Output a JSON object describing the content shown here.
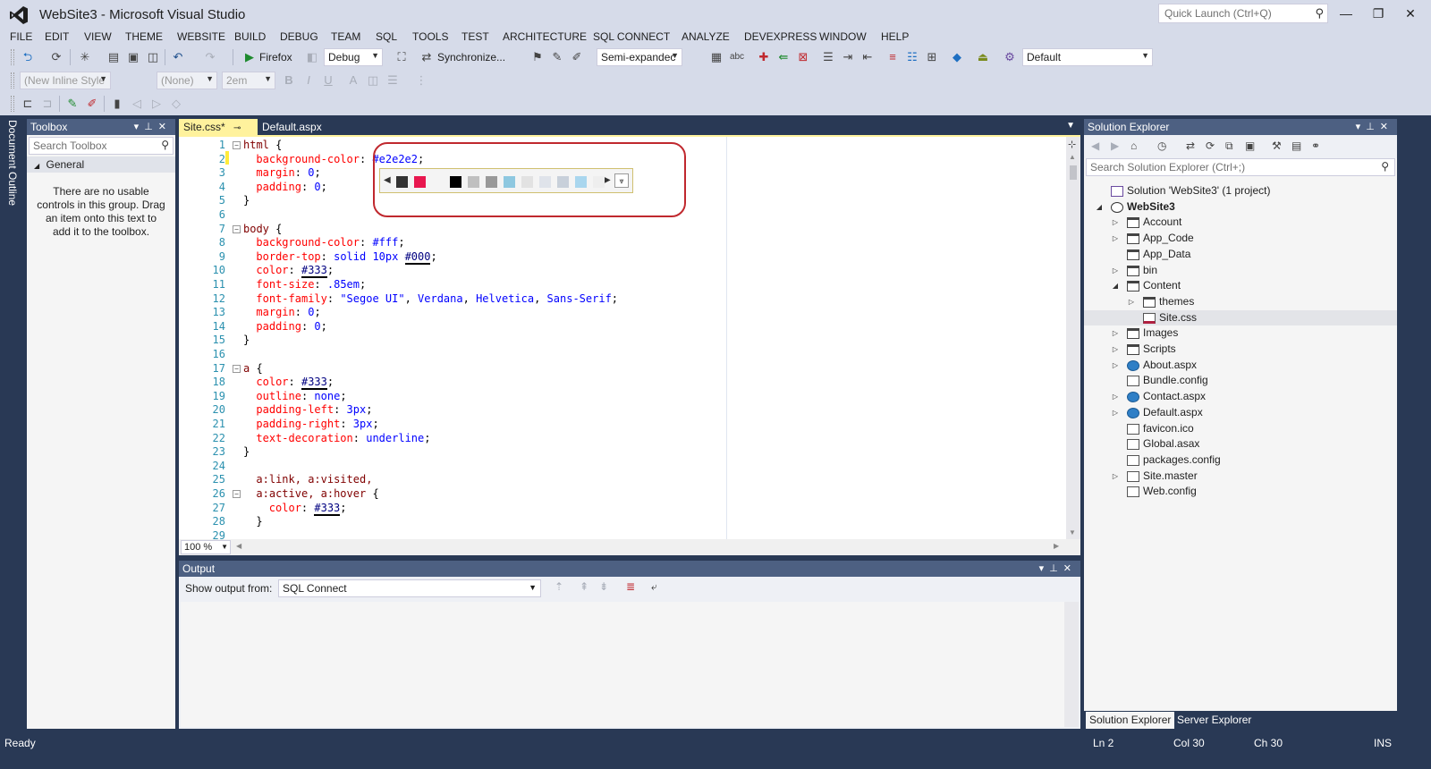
{
  "window": {
    "title": "WebSite3 - Microsoft Visual Studio",
    "quick_launch_placeholder": "Quick Launch (Ctrl+Q)",
    "minimize": "—",
    "restore": "❐",
    "close": "✕"
  },
  "menu": [
    "FILE",
    "EDIT",
    "VIEW",
    "THEME",
    "WEBSITE",
    "BUILD",
    "DEBUG",
    "TEAM",
    "SQL",
    "TOOLS",
    "TEST",
    "ARCHITECTURE",
    "SQL CONNECT",
    "ANALYZE",
    "DEVEXPRESS",
    "WINDOW",
    "HELP"
  ],
  "toolbar": {
    "run_target": "Firefox",
    "config": "Debug",
    "synchronize": "Synchronize...",
    "outline_mode": "Semi-expandec",
    "layout": "Default",
    "style_combo": "(New Inline Style",
    "font_combo": "(None)",
    "size_combo": "2em"
  },
  "toolbox": {
    "title": "Toolbox",
    "search_placeholder": "Search Toolbox",
    "group": "General",
    "empty_text": "There are no usable controls in this group. Drag an item onto this text to add it to the toolbox."
  },
  "left_tab": "Document Outline",
  "editor": {
    "tabs": [
      "Site.css*",
      "Default.aspx"
    ],
    "zoom": "100 %",
    "swatches": [
      "#333333",
      "#e8174f",
      "#f4f4f4",
      "#000000",
      "#c0c0c0",
      "#999999",
      "#8ec8e0",
      "#e2e2e2",
      "#dfe3ea",
      "#c8d0da",
      "#a9d6ee",
      "#eeeeee"
    ],
    "lines": [
      {
        "n": "1",
        "fold": "−",
        "indent": 0,
        "parts": [
          [
            "sel",
            "html"
          ],
          [
            "pun",
            " {"
          ]
        ]
      },
      {
        "n": "2",
        "fold": "",
        "indent": 2,
        "parts": [
          [
            "prop",
            "background-color"
          ],
          [
            "pun",
            ": "
          ],
          [
            "val",
            "#e2e2e2"
          ],
          [
            "pun",
            ";"
          ]
        ]
      },
      {
        "n": "3",
        "fold": "",
        "indent": 2,
        "parts": [
          [
            "prop",
            "margin"
          ],
          [
            "pun",
            ": "
          ],
          [
            "val",
            "0"
          ],
          [
            "pun",
            ";"
          ]
        ]
      },
      {
        "n": "4",
        "fold": "",
        "indent": 2,
        "parts": [
          [
            "prop",
            "padding"
          ],
          [
            "pun",
            ": "
          ],
          [
            "val",
            "0"
          ],
          [
            "pun",
            ";"
          ]
        ]
      },
      {
        "n": "5",
        "fold": "",
        "indent": 0,
        "parts": [
          [
            "pun",
            "}"
          ]
        ]
      },
      {
        "n": "6",
        "fold": "",
        "indent": 0,
        "parts": []
      },
      {
        "n": "7",
        "fold": "−",
        "indent": 0,
        "parts": [
          [
            "sel",
            "body"
          ],
          [
            "pun",
            " {"
          ]
        ]
      },
      {
        "n": "8",
        "fold": "",
        "indent": 2,
        "parts": [
          [
            "prop",
            "background-color"
          ],
          [
            "pun",
            ": "
          ],
          [
            "val",
            "#fff"
          ],
          [
            "pun",
            ";"
          ]
        ]
      },
      {
        "n": "9",
        "fold": "",
        "indent": 2,
        "parts": [
          [
            "prop",
            "border-top"
          ],
          [
            "pun",
            ": "
          ],
          [
            "val",
            "solid 10px "
          ],
          [
            "hex",
            "#000"
          ],
          [
            "pun",
            ";"
          ]
        ]
      },
      {
        "n": "10",
        "fold": "",
        "indent": 2,
        "parts": [
          [
            "prop",
            "color"
          ],
          [
            "pun",
            ": "
          ],
          [
            "hex",
            "#333"
          ],
          [
            "pun",
            ";"
          ]
        ]
      },
      {
        "n": "11",
        "fold": "",
        "indent": 2,
        "parts": [
          [
            "prop",
            "font-size"
          ],
          [
            "pun",
            ": "
          ],
          [
            "val",
            ".85em"
          ],
          [
            "pun",
            ";"
          ]
        ]
      },
      {
        "n": "12",
        "fold": "",
        "indent": 2,
        "parts": [
          [
            "prop",
            "font-family"
          ],
          [
            "pun",
            ": "
          ],
          [
            "val",
            "\"Segoe UI\""
          ],
          [
            "pun",
            ", "
          ],
          [
            "val",
            "Verdana"
          ],
          [
            "pun",
            ", "
          ],
          [
            "val",
            "Helvetica"
          ],
          [
            "pun",
            ", "
          ],
          [
            "val",
            "Sans-Serif"
          ],
          [
            "pun",
            ";"
          ]
        ]
      },
      {
        "n": "13",
        "fold": "",
        "indent": 2,
        "parts": [
          [
            "prop",
            "margin"
          ],
          [
            "pun",
            ": "
          ],
          [
            "val",
            "0"
          ],
          [
            "pun",
            ";"
          ]
        ]
      },
      {
        "n": "14",
        "fold": "",
        "indent": 2,
        "parts": [
          [
            "prop",
            "padding"
          ],
          [
            "pun",
            ": "
          ],
          [
            "val",
            "0"
          ],
          [
            "pun",
            ";"
          ]
        ]
      },
      {
        "n": "15",
        "fold": "",
        "indent": 0,
        "parts": [
          [
            "pun",
            "}"
          ]
        ]
      },
      {
        "n": "16",
        "fold": "",
        "indent": 0,
        "parts": []
      },
      {
        "n": "17",
        "fold": "−",
        "indent": 0,
        "parts": [
          [
            "sel",
            "a"
          ],
          [
            "pun",
            " {"
          ]
        ]
      },
      {
        "n": "18",
        "fold": "",
        "indent": 2,
        "parts": [
          [
            "prop",
            "color"
          ],
          [
            "pun",
            ": "
          ],
          [
            "hex",
            "#333"
          ],
          [
            "pun",
            ";"
          ]
        ]
      },
      {
        "n": "19",
        "fold": "",
        "indent": 2,
        "parts": [
          [
            "prop",
            "outline"
          ],
          [
            "pun",
            ": "
          ],
          [
            "val",
            "none"
          ],
          [
            "pun",
            ";"
          ]
        ]
      },
      {
        "n": "20",
        "fold": "",
        "indent": 2,
        "parts": [
          [
            "prop",
            "padding-left"
          ],
          [
            "pun",
            ": "
          ],
          [
            "val",
            "3px"
          ],
          [
            "pun",
            ";"
          ]
        ]
      },
      {
        "n": "21",
        "fold": "",
        "indent": 2,
        "parts": [
          [
            "prop",
            "padding-right"
          ],
          [
            "pun",
            ": "
          ],
          [
            "val",
            "3px"
          ],
          [
            "pun",
            ";"
          ]
        ]
      },
      {
        "n": "22",
        "fold": "",
        "indent": 2,
        "parts": [
          [
            "prop",
            "text-decoration"
          ],
          [
            "pun",
            ": "
          ],
          [
            "val",
            "underline"
          ],
          [
            "pun",
            ";"
          ]
        ]
      },
      {
        "n": "23",
        "fold": "",
        "indent": 0,
        "parts": [
          [
            "pun",
            "}"
          ]
        ]
      },
      {
        "n": "24",
        "fold": "",
        "indent": 0,
        "parts": []
      },
      {
        "n": "25",
        "fold": "",
        "indent": 2,
        "parts": [
          [
            "sel",
            "a:link, a:visited,"
          ]
        ]
      },
      {
        "n": "26",
        "fold": "−",
        "indent": 2,
        "parts": [
          [
            "sel",
            "a:active, a:hover"
          ],
          [
            "pun",
            " {"
          ]
        ]
      },
      {
        "n": "27",
        "fold": "",
        "indent": 4,
        "parts": [
          [
            "prop",
            "color"
          ],
          [
            "pun",
            ": "
          ],
          [
            "hex",
            "#333"
          ],
          [
            "pun",
            ";"
          ]
        ]
      },
      {
        "n": "28",
        "fold": "",
        "indent": 2,
        "parts": [
          [
            "pun",
            "}"
          ]
        ]
      },
      {
        "n": "29",
        "fold": "",
        "indent": 0,
        "parts": []
      }
    ]
  },
  "output": {
    "title": "Output",
    "show_from_label": "Show output from:",
    "source": "SQL Connect"
  },
  "solution": {
    "title": "Solution Explorer",
    "search_placeholder": "Search Solution Explorer (Ctrl+;)",
    "tree": [
      {
        "label": "Solution 'WebSite3' (1 project)",
        "depth": 0,
        "exp": "",
        "icon": "sol",
        "bold": false
      },
      {
        "label": "WebSite3",
        "depth": 0,
        "exp": "◢",
        "icon": "globe",
        "bold": true
      },
      {
        "label": "Account",
        "depth": 1,
        "exp": "▷",
        "icon": "folder",
        "bold": false
      },
      {
        "label": "App_Code",
        "depth": 1,
        "exp": "▷",
        "icon": "folder",
        "bold": false
      },
      {
        "label": "App_Data",
        "depth": 1,
        "exp": "",
        "icon": "folder",
        "bold": false
      },
      {
        "label": "bin",
        "depth": 1,
        "exp": "▷",
        "icon": "folder",
        "bold": false
      },
      {
        "label": "Content",
        "depth": 1,
        "exp": "◢",
        "icon": "folder",
        "bold": false
      },
      {
        "label": "themes",
        "depth": 2,
        "exp": "▷",
        "icon": "folder",
        "bold": false
      },
      {
        "label": "Site.css",
        "depth": 2,
        "exp": "",
        "icon": "css",
        "bold": false,
        "selected": true
      },
      {
        "label": "Images",
        "depth": 1,
        "exp": "▷",
        "icon": "folder",
        "bold": false
      },
      {
        "label": "Scripts",
        "depth": 1,
        "exp": "▷",
        "icon": "folder",
        "bold": false
      },
      {
        "label": "About.aspx",
        "depth": 1,
        "exp": "▷",
        "icon": "web",
        "bold": false
      },
      {
        "label": "Bundle.config",
        "depth": 1,
        "exp": "",
        "icon": "file",
        "bold": false
      },
      {
        "label": "Contact.aspx",
        "depth": 1,
        "exp": "▷",
        "icon": "web",
        "bold": false
      },
      {
        "label": "Default.aspx",
        "depth": 1,
        "exp": "▷",
        "icon": "web",
        "bold": false
      },
      {
        "label": "favicon.ico",
        "depth": 1,
        "exp": "",
        "icon": "file",
        "bold": false
      },
      {
        "label": "Global.asax",
        "depth": 1,
        "exp": "",
        "icon": "file",
        "bold": false
      },
      {
        "label": "packages.config",
        "depth": 1,
        "exp": "",
        "icon": "file",
        "bold": false
      },
      {
        "label": "Site.master",
        "depth": 1,
        "exp": "▷",
        "icon": "file",
        "bold": false
      },
      {
        "label": "Web.config",
        "depth": 1,
        "exp": "",
        "icon": "file",
        "bold": false
      }
    ],
    "tabs": [
      "Solution Explorer",
      "Server Explorer"
    ]
  },
  "status": {
    "left": "Ready",
    "line": "Ln 2",
    "col": "Col 30",
    "ch": "Ch 30",
    "mode": "INS"
  },
  "colors": {
    "accent": "#fff29d",
    "chrome": "#d6dbe9",
    "frame": "#293955",
    "panel_header": "#4d6082",
    "annotation": "#c0282e"
  }
}
